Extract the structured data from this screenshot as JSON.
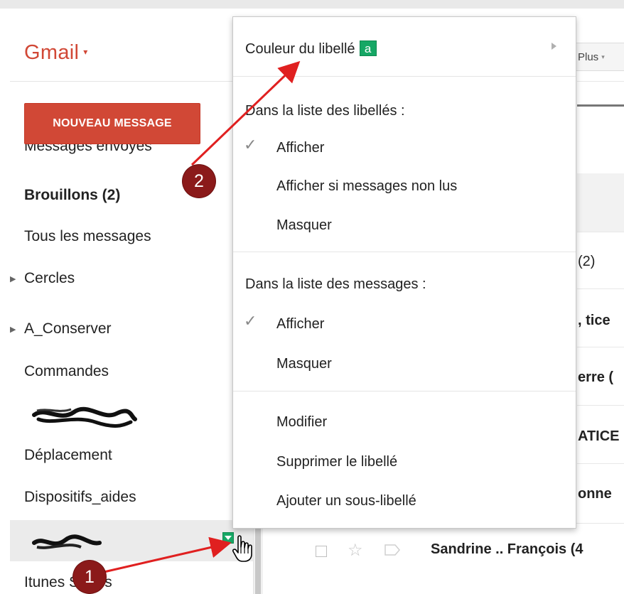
{
  "header": {
    "logo": "Gmail",
    "logo_caret": "▾",
    "more_button": "Plus",
    "more_caret": "▾"
  },
  "compose": {
    "label": "NOUVEAU MESSAGE"
  },
  "sidebar": {
    "partial_item": "Messages envoyés",
    "items": [
      {
        "label": "Brouillons (2)",
        "bold": true
      },
      {
        "label": "Tous les messages"
      },
      {
        "label": "Cercles",
        "arrow": "▶"
      },
      {
        "label": "A_Conserver",
        "arrow": "▶"
      },
      {
        "label": "Commandes"
      },
      {
        "label": "Déplacement"
      },
      {
        "label": "Dispositifs_aides"
      },
      {
        "label": "Itunes Stores"
      }
    ]
  },
  "menu": {
    "label_color": "Couleur du libellé",
    "label_color_swatch": "a",
    "section_labels_list": "Dans la liste des libellés :",
    "labels_list_options": [
      "Afficher",
      "Afficher si messages non lus",
      "Masquer"
    ],
    "section_messages_list": "Dans la liste des messages :",
    "messages_list_options": [
      "Afficher",
      "Masquer"
    ],
    "actions": [
      "Modifier",
      "Supprimer le libellé",
      "Ajouter un sous-libellé"
    ],
    "checkmark": "✓"
  },
  "background_list": {
    "fragments": [
      "(2)",
      ", tice",
      "erre (",
      "ATICE",
      "onne"
    ],
    "row_sender": "Sandrine .. François (4"
  },
  "annotations": {
    "step1": "1",
    "step2": "2"
  },
  "colors": {
    "gmail_red": "#d14836",
    "label_green": "#16a765",
    "annotation_red": "#e02020",
    "badge_dark_red": "#8b1a1a"
  },
  "icons": [
    "label-dropdown-icon",
    "hand-cursor-icon",
    "checkmark-icon",
    "submenu-arrow-icon",
    "star-icon",
    "tag-icon"
  ]
}
